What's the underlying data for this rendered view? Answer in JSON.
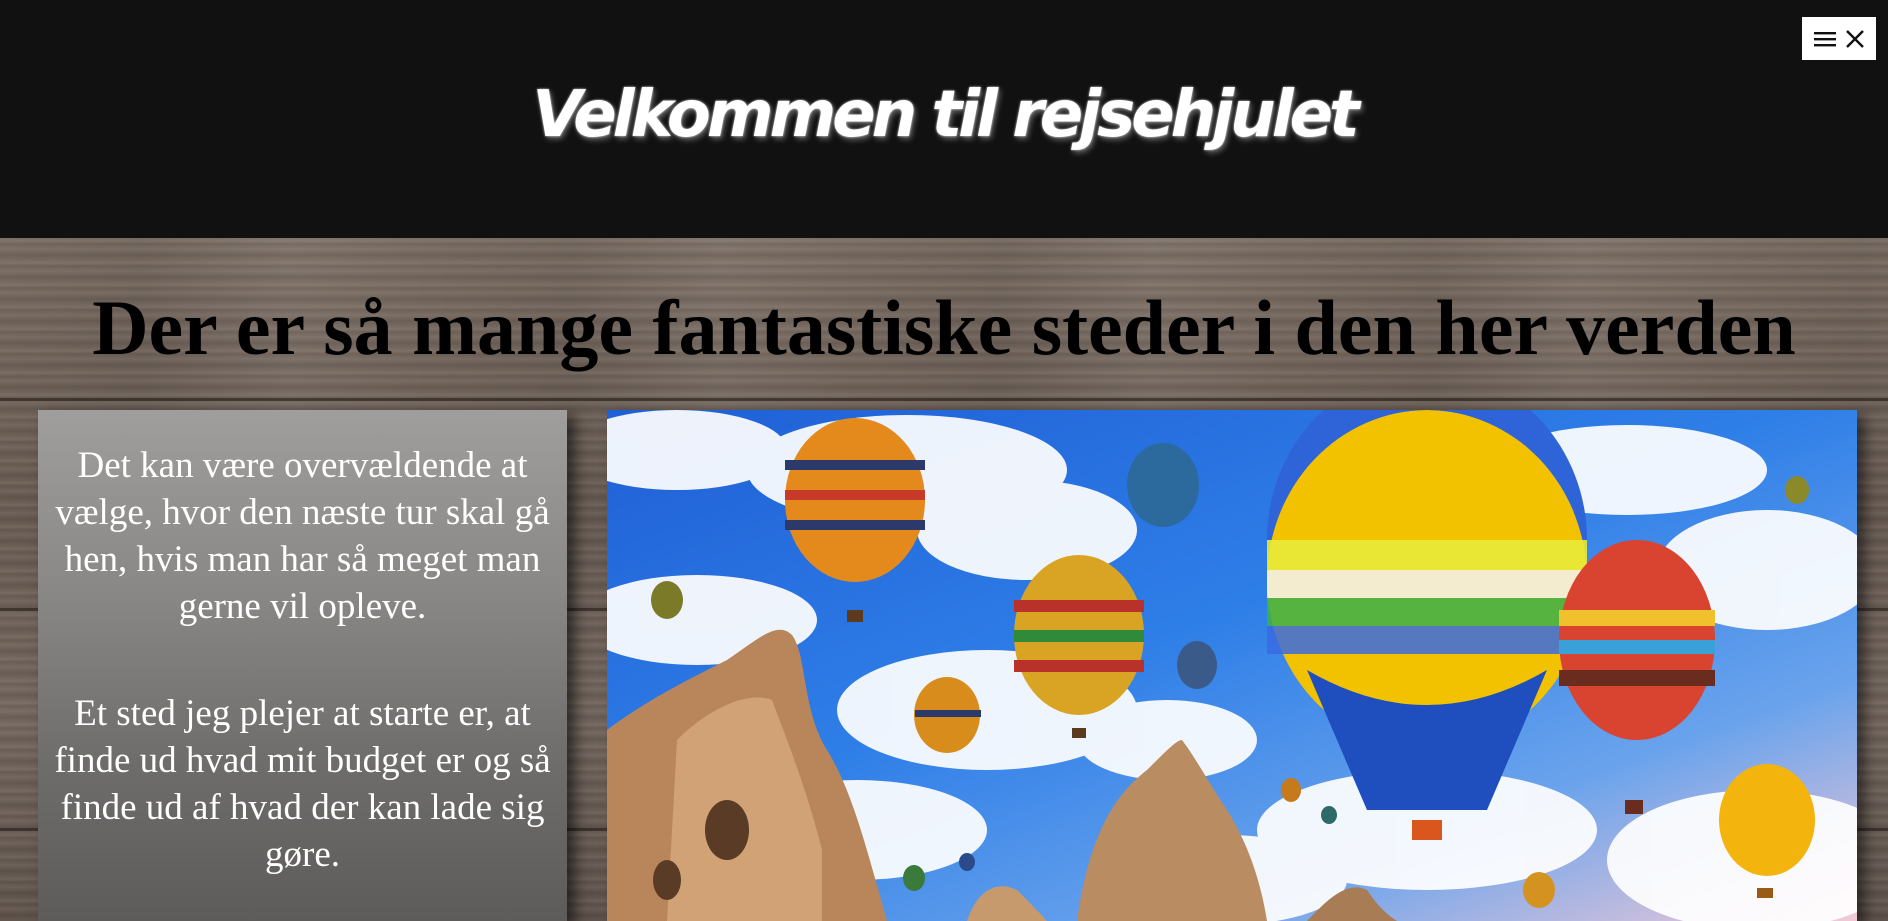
{
  "header": {
    "title": "Velkommen til rejsehjulet",
    "menu_icons": [
      "hamburger-icon",
      "close-icon"
    ]
  },
  "main": {
    "heading": "Der er så mange fantastiske steder i den her verden",
    "paragraphs": [
      "Det kan være overvældende at vælge, hvor den næste tur skal gå hen, hvis man har så meget man gerne vil opleve.",
      "Et sted jeg plejer at starte er, at finde ud hvad mit budget er og så finde ud af hvad der kan lade sig gøre."
    ],
    "image": {
      "subject": "hot air balloons over rock formations"
    }
  },
  "colors": {
    "header_bg": "#111111",
    "title_text": "#ffffff",
    "heading_text": "#000000",
    "card_text": "#ffffff",
    "sky": "#2f7fe8"
  }
}
